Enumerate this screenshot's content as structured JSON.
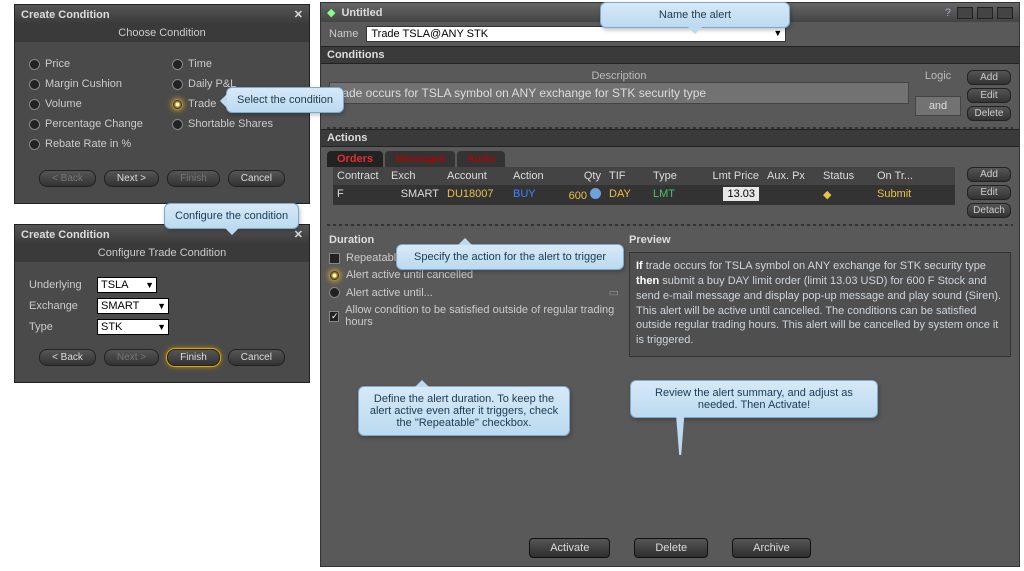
{
  "dialog1": {
    "title": "Create Condition",
    "subtitle": "Choose Condition",
    "options": {
      "price": "Price",
      "time": "Time",
      "margin": "Margin Cushion",
      "pnl": "Daily P&L",
      "volume": "Volume",
      "trade": "Trade",
      "pct": "Percentage Change",
      "shorts": "Shortable Shares",
      "rebate": "Rebate Rate in %"
    },
    "buttons": {
      "back": "< Back",
      "next": "Next >",
      "finish": "Finish",
      "cancel": "Cancel"
    }
  },
  "dialog2": {
    "title": "Create Condition",
    "subtitle": "Configure Trade Condition",
    "fields": {
      "underlying_label": "Underlying",
      "underlying_value": "TSLA",
      "exchange_label": "Exchange",
      "exchange_value": "SMART",
      "type_label": "Type",
      "type_value": "STK"
    },
    "buttons": {
      "back": "< Back",
      "next": "Next >",
      "finish": "Finish",
      "cancel": "Cancel"
    }
  },
  "main": {
    "title": "Untitled",
    "name_label": "Name",
    "name_value": "Trade TSLA@ANY STK",
    "sections": {
      "conditions": "Conditions",
      "actions": "Actions",
      "duration": "Duration",
      "preview": "Preview"
    },
    "conditions": {
      "desc_header": "Description",
      "desc_value": "trade occurs for TSLA symbol on ANY exchange for STK security type",
      "logic_header": "Logic",
      "logic_value": "and",
      "buttons": {
        "add": "Add",
        "edit": "Edit",
        "delete": "Delete"
      }
    },
    "actions": {
      "tabs": {
        "orders": "Orders",
        "messages": "Messages",
        "audio": "Audio"
      },
      "columns": {
        "contract": "Contract",
        "exch": "Exch",
        "account": "Account",
        "action": "Action",
        "qty": "Qty",
        "tif": "TIF",
        "type": "Type",
        "lmt": "Lmt Price",
        "aux": "Aux. Px",
        "status": "Status",
        "ontr": "On Tr..."
      },
      "row": {
        "contract": "F",
        "exch": "SMART",
        "account": "DU18007",
        "action": "BUY",
        "qty": "600",
        "tif": "DAY",
        "type": "LMT",
        "lmt": "13.03",
        "aux": "",
        "status": "",
        "ontr": "Submit"
      },
      "buttons": {
        "add": "Add",
        "edit": "Edit",
        "detach": "Detach"
      }
    },
    "duration": {
      "repeatable": "Repeatable",
      "active_cancel": "Alert active until cancelled",
      "active_until": "Alert active until...",
      "outside_hours": "Allow condition to be satisfied outside of regular trading hours"
    },
    "preview_text_pre": "If ",
    "preview_text_1": "trade occurs for TSLA symbol on ANY exchange for STK security type ",
    "preview_text_then": "then ",
    "preview_text_2": "submit a buy DAY limit order (limit 13.03 USD) for 600 F Stock and send e-mail message and display pop-up message and play sound (Siren). This alert will be active until cancelled. The conditions can be satisfied outside regular trading hours. This alert will be cancelled by system once it is triggered.",
    "footer": {
      "activate": "Activate",
      "delete": "Delete",
      "archive": "Archive"
    }
  },
  "callouts": {
    "name": "Name the alert",
    "select_cond": "Select the condition",
    "configure_cond": "Configure the condition",
    "specify_action": "Specify the action for the alert to trigger",
    "duration": "Define the alert duration. To keep the alert active even after it triggers, check the \"Repeatable\" checkbox.",
    "review": "Review the alert summary, and adjust as needed. Then Activate!"
  }
}
